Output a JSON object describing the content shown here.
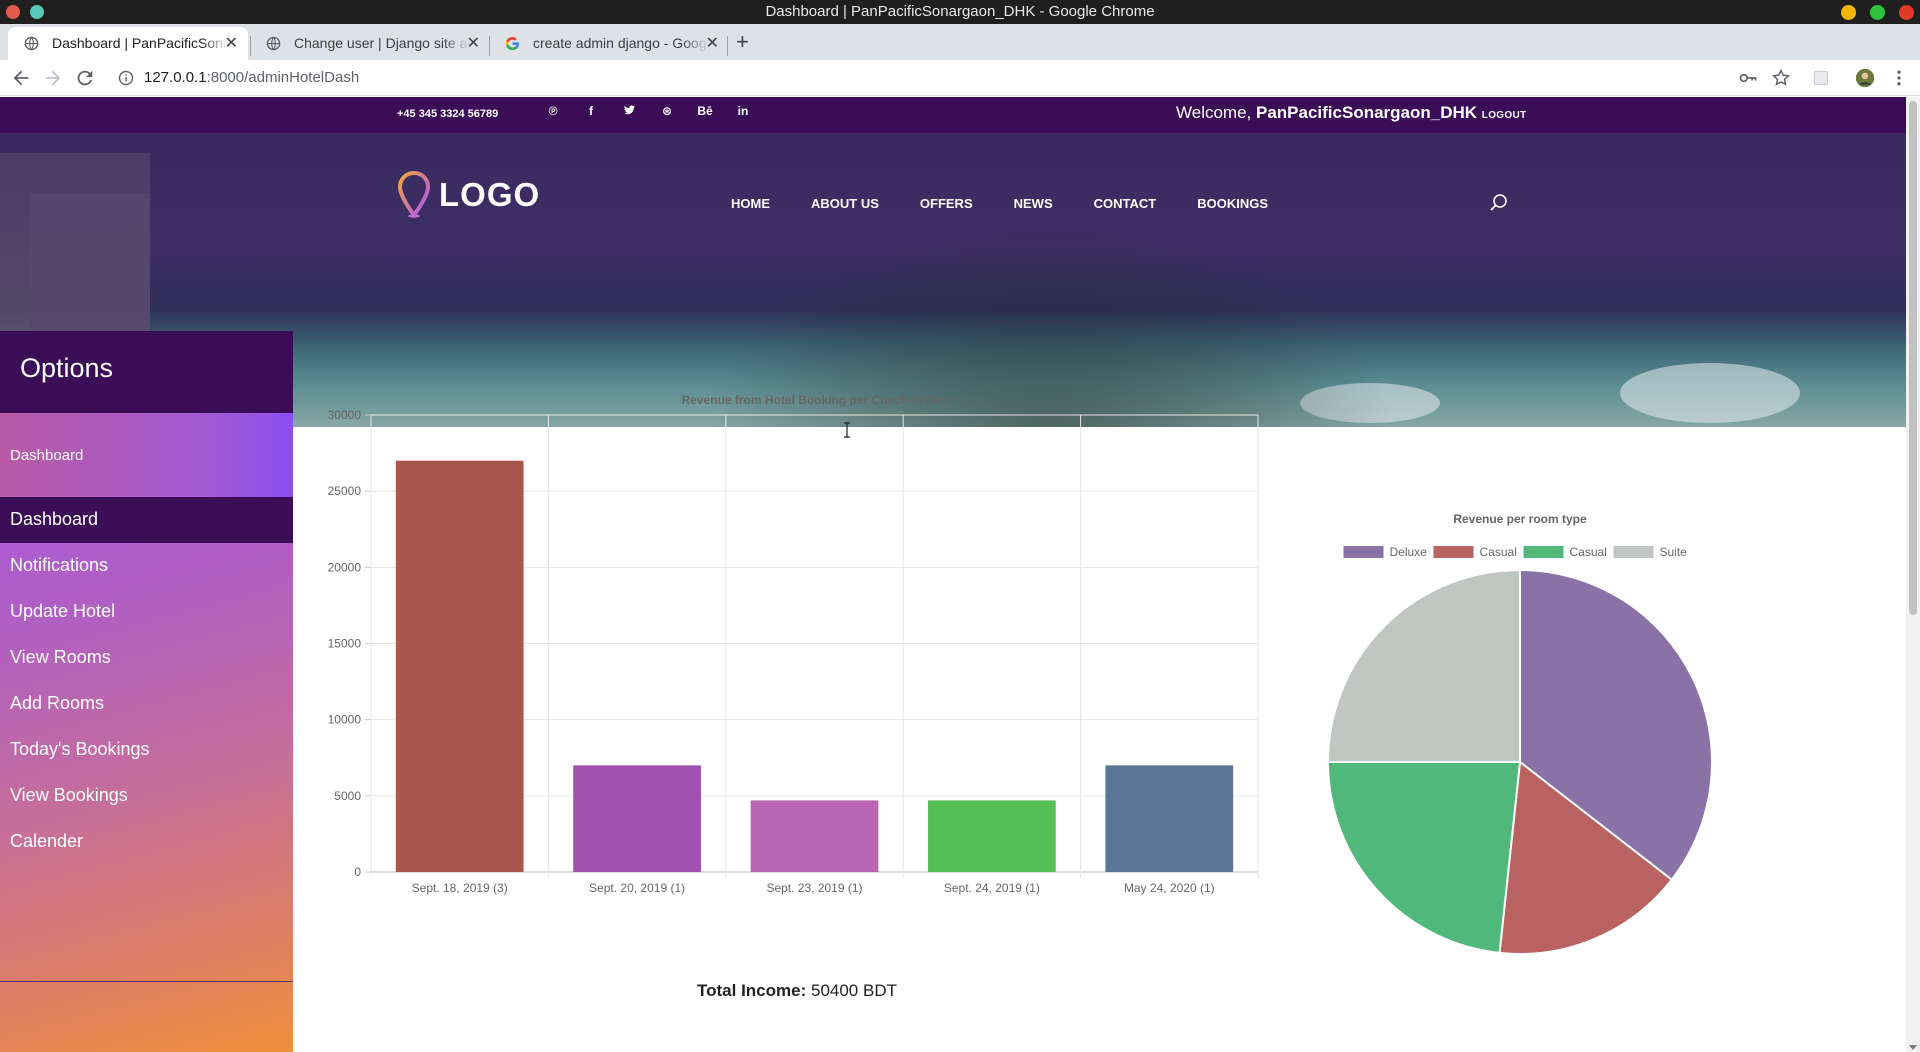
{
  "window": {
    "title": "Dashboard | PanPacificSonargaon_DHK - Google Chrome"
  },
  "tabs": [
    {
      "label": "Dashboard | PanPacificSonargaon_DHK",
      "active": true
    },
    {
      "label": "Change user | Django site admin",
      "active": false
    },
    {
      "label": "create admin django - Google Search",
      "active": false
    }
  ],
  "toolbar": {
    "url_host": "127.0.0.1",
    "url_rest": ":8000/adminHotelDash"
  },
  "topbar": {
    "phone": "+45 345 3324 56789",
    "socials": [
      "pinterest-icon",
      "facebook-icon",
      "twitter-icon",
      "dribbble-icon",
      "behance-icon",
      "linkedin-icon"
    ],
    "social_glyphs": [
      "℗",
      "f",
      "🐦",
      "⊛",
      "Bē",
      "in"
    ],
    "welcome_prefix": "Welcome,",
    "username": "PanPacificSonargaon_DHK",
    "logout": "LOGOUT"
  },
  "header": {
    "logo_text": "LOGO",
    "nav": [
      "HOME",
      "ABOUT US",
      "OFFERS",
      "NEWS",
      "CONTACT",
      "BOOKINGS"
    ]
  },
  "sidebar": {
    "title": "Options",
    "sub": "Dashboard",
    "items": [
      {
        "label": "Dashboard",
        "active": true
      },
      {
        "label": "Notifications",
        "active": false
      },
      {
        "label": "Update Hotel",
        "active": false
      },
      {
        "label": "View Rooms",
        "active": false
      },
      {
        "label": "Add Rooms",
        "active": false
      },
      {
        "label": "Today's Bookings",
        "active": false
      },
      {
        "label": "View Bookings",
        "active": false
      },
      {
        "label": "Calender",
        "active": false
      }
    ]
  },
  "total": {
    "label": "Total Income:",
    "value": "50400 BDT"
  },
  "chart_data": [
    {
      "type": "bar",
      "title": "Revenue from Hotel Booking per Check-in Day",
      "categories": [
        "Sept. 18, 2019 (3)",
        "Sept. 20, 2019 (1)",
        "Sept. 23, 2019 (1)",
        "Sept. 24, 2019 (1)",
        "May 24, 2020 (1)"
      ],
      "values": [
        27000,
        7000,
        4700,
        4700,
        7000
      ],
      "colors": [
        "#a9564c",
        "#a152b1",
        "#b967b2",
        "#55bf55",
        "#5c7596"
      ],
      "ylim": [
        0,
        30000
      ],
      "yticks": [
        0,
        5000,
        10000,
        15000,
        20000,
        25000,
        30000
      ],
      "grid": true
    },
    {
      "type": "pie",
      "title": "Revenue per room type",
      "labels": [
        "Deluxe",
        "Casual",
        "Casual",
        "Suite"
      ],
      "values": [
        35.5,
        16.2,
        23.3,
        25.0
      ],
      "colors": [
        "#8a71a6",
        "#b96262",
        "#50b87a",
        "#c2c6c3"
      ],
      "legend": "top"
    }
  ]
}
